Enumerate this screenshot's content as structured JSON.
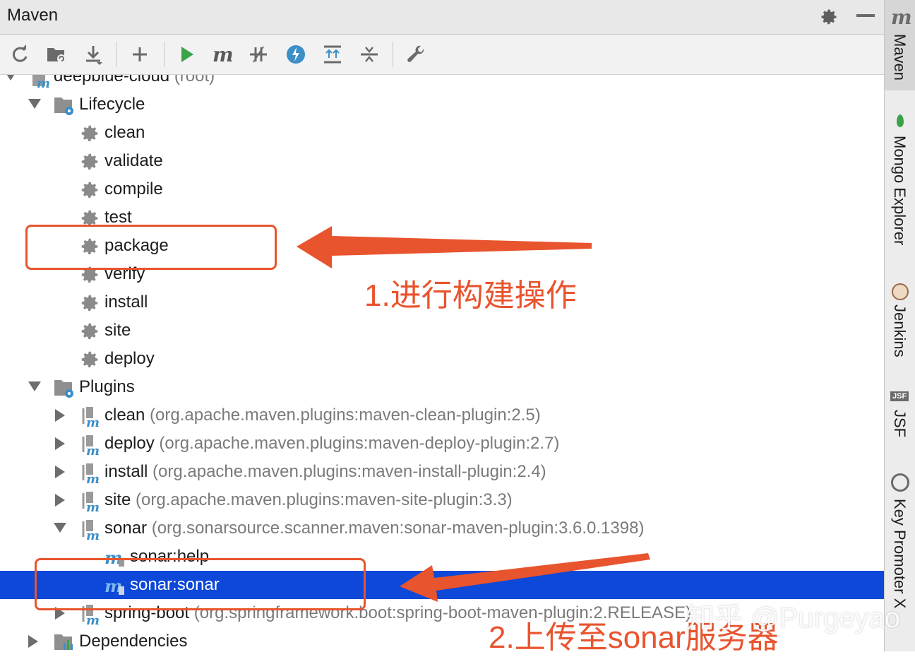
{
  "panel": {
    "title": "Maven"
  },
  "tree": {
    "root_label": "deepblue-cloud",
    "root_sub": "(root)",
    "lifecycle_label": "Lifecycle",
    "lifecycle": [
      "clean",
      "validate",
      "compile",
      "test",
      "package",
      "verify",
      "install",
      "site",
      "deploy"
    ],
    "plugins_label": "Plugins",
    "plugins": [
      {
        "name": "clean",
        "detail": "(org.apache.maven.plugins:maven-clean-plugin:2.5)"
      },
      {
        "name": "deploy",
        "detail": "(org.apache.maven.plugins:maven-deploy-plugin:2.7)"
      },
      {
        "name": "install",
        "detail": "(org.apache.maven.plugins:maven-install-plugin:2.4)"
      },
      {
        "name": "site",
        "detail": "(org.apache.maven.plugins:maven-site-plugin:3.3)"
      },
      {
        "name": "sonar",
        "detail": "(org.sonarsource.scanner.maven:sonar-maven-plugin:3.6.0.1398)"
      }
    ],
    "sonar_goals": [
      "sonar:help",
      "sonar:sonar"
    ],
    "spring_boot": {
      "name": "spring-boot",
      "detail": "(org.springframework.boot:spring-boot-maven-plugin:2.RELEASE)"
    },
    "dependencies_label": "Dependencies"
  },
  "side_tabs": [
    "Maven",
    "Mongo Explorer",
    "Jenkins",
    "JSF",
    "Key Promoter X"
  ],
  "side_icons": {
    "jsf_badge": "JSF"
  },
  "annotations": {
    "note1": "1.进行构建操作",
    "note2": "2.上传至sonar服务器",
    "watermark": "知乎 @Purgeyao"
  },
  "colors": {
    "accent_annotation": "#e8542e",
    "selection": "#0d48d8",
    "run_green": "#3aa34a",
    "maven_blue": "#3c8fc7"
  }
}
